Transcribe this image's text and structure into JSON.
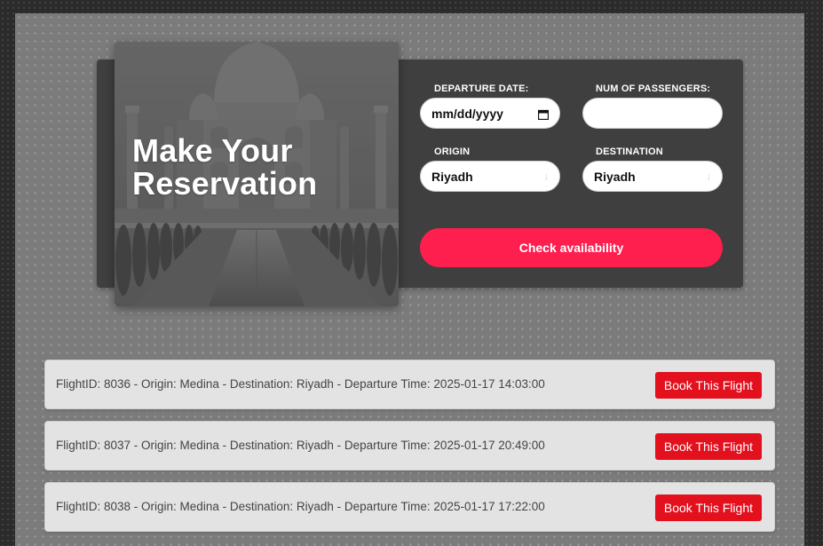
{
  "hero": {
    "title_line1": "Make Your",
    "title_line2": "Reservation"
  },
  "form": {
    "departure_label": "DEPARTURE DATE:",
    "departure_value": "mm/dd/yyyy",
    "passengers_label": "NUM OF PASSENGERS:",
    "passengers_value": "",
    "origin_label": "ORIGIN",
    "origin_value": "Riyadh",
    "destination_label": "DESTINATION",
    "destination_value": "Riyadh",
    "submit_label": "Check availability"
  },
  "flights": [
    {
      "text": "FlightID: 8036 - Origin: Medina - Destination: Riyadh - Departure Time: 2025-01-17 14:03:00",
      "button": "Book This Flight"
    },
    {
      "text": "FlightID: 8037 - Origin: Medina - Destination: Riyadh - Departure Time: 2025-01-17 20:49:00",
      "button": "Book This Flight"
    },
    {
      "text": "FlightID: 8038 - Origin: Medina - Destination: Riyadh - Departure Time: 2025-01-17 17:22:00",
      "button": "Book This Flight"
    }
  ],
  "colors": {
    "accent": "#ff1f4f",
    "book_button": "#e3101e",
    "card_bg": "#3f3f3f",
    "page_bg": "#7b7b7b"
  },
  "icons": {
    "date": "calendar-icon",
    "select": "chevron-down-icon"
  }
}
